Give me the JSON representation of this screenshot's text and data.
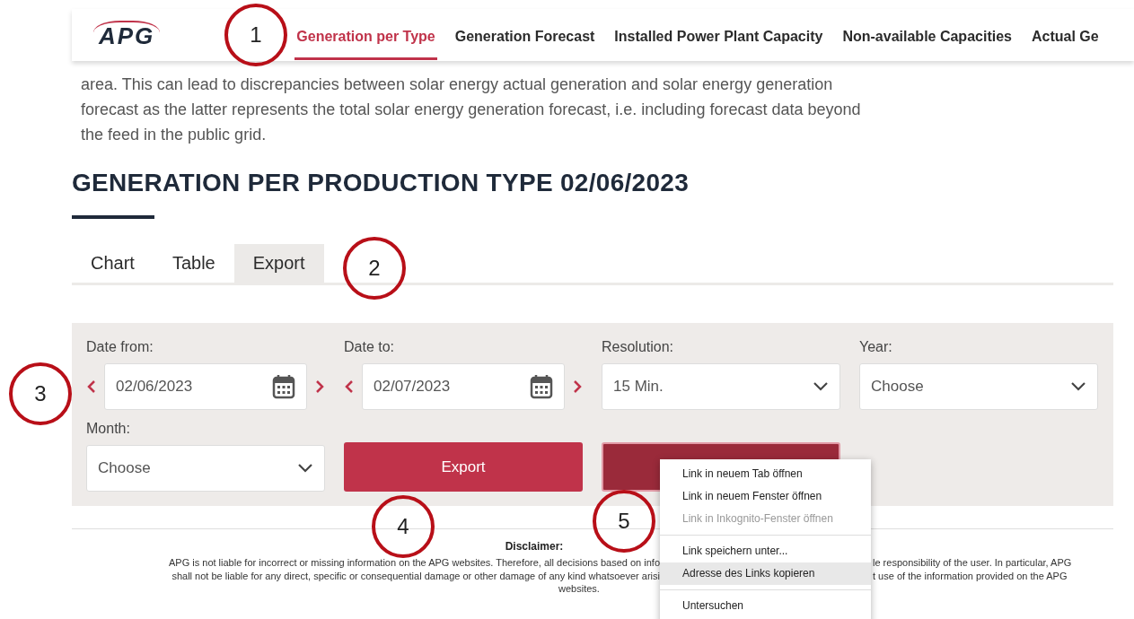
{
  "header": {
    "logo": "APG",
    "nav": [
      {
        "label": "Generation per Type",
        "selected": true
      },
      {
        "label": "Generation Forecast",
        "selected": false
      },
      {
        "label": "Installed Power Plant Capacity",
        "selected": false
      },
      {
        "label": "Non-available Capacities",
        "selected": false
      },
      {
        "label": "Actual Ge",
        "selected": false
      }
    ]
  },
  "intro": "area. This can lead to discrepancies between solar energy actual generation and solar energy generation forecast as the latter represents the total solar energy generation forecast, i.e. including forecast data beyond the feed in the public grid.",
  "heading": "GENERATION PER PRODUCTION TYPE 02/06/2023",
  "tabs": [
    {
      "label": "Chart",
      "selected": false
    },
    {
      "label": "Table",
      "selected": false
    },
    {
      "label": "Export",
      "selected": true
    }
  ],
  "form": {
    "fields": [
      {
        "kind": "date",
        "label": "Date from:",
        "value": "02/06/2023"
      },
      {
        "kind": "date",
        "label": "Date to:",
        "value": "02/07/2023"
      },
      {
        "kind": "select",
        "label": "Resolution:",
        "value": "15 Min."
      },
      {
        "kind": "select",
        "label": "Year:",
        "value": "Choose"
      },
      {
        "kind": "select",
        "label": "Month:",
        "value": "Choose"
      }
    ],
    "buttons": [
      {
        "kind": "primary",
        "label": "Export"
      },
      {
        "kind": "dark"
      }
    ]
  },
  "disclaimer": {
    "title": "Disclaimer:",
    "lines": [
      {
        "kind": "split",
        "left": "APG is not liable for incorrect or missing information on the APG websites. Therefore, all decisions based on info",
        "right": "le responsibility of the user. In particular, APG"
      },
      {
        "kind": "split",
        "left": "shall not be liable for any direct, specific or consequential damage or other damage of any kind whatsoever arisi",
        "right": "t use of the information provided on the APG"
      },
      {
        "kind": "center",
        "left": "websites."
      }
    ]
  },
  "context_menu": {
    "groups": [
      [
        {
          "label": "Link in neuem Tab öffnen",
          "disabled": false,
          "selected": false
        },
        {
          "label": "Link in neuem Fenster öffnen",
          "disabled": false,
          "selected": false
        },
        {
          "label": "Link in Inkognito-Fenster öffnen",
          "disabled": true,
          "selected": false
        }
      ],
      [
        {
          "label": "Link speichern unter...",
          "disabled": false,
          "selected": false
        },
        {
          "label": "Adresse des Links kopieren",
          "disabled": false,
          "selected": true
        }
      ],
      [
        {
          "label": "Untersuchen",
          "disabled": false,
          "selected": false
        }
      ]
    ]
  },
  "annotations": [
    "1",
    "2",
    "3",
    "4",
    "5"
  ]
}
